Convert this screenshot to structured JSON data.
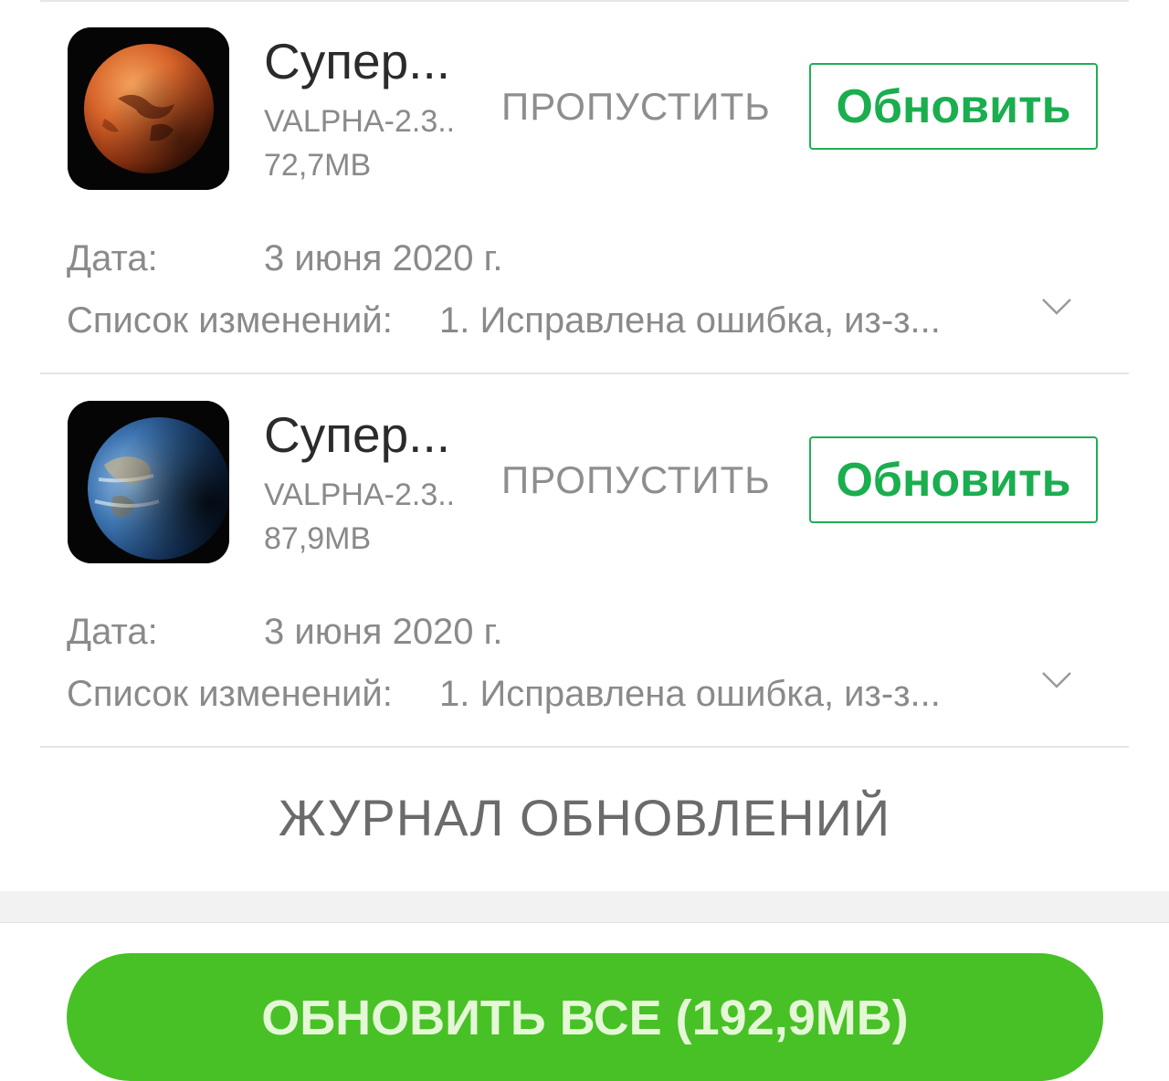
{
  "updates": [
    {
      "name": "Супер...",
      "version": "VALPHA-2.3..",
      "size": "72,7MB",
      "skip_label": "ПРОПУСТИТЬ",
      "update_label": "Обновить",
      "date_label": "Дата:",
      "date_value": "3 июня 2020 г.",
      "changelog_label": "Список изменений:",
      "changelog_value": "1. Исправлена ошибка, из-з...",
      "icon": "mars-wallpaper-icon"
    },
    {
      "name": "Супер...",
      "version": "VALPHA-2.3..",
      "size": "87,9MB",
      "skip_label": "ПРОПУСТИТЬ",
      "update_label": "Обновить",
      "date_label": "Дата:",
      "date_value": "3 июня 2020 г.",
      "changelog_label": "Список изменений:",
      "changelog_value": "1. Исправлена ошибка, из-з...",
      "icon": "earth-wallpaper-icon"
    }
  ],
  "journal_label": "ЖУРНАЛ ОБНОВЛЕНИЙ",
  "update_all_label": "ОБНОВИТЬ ВСЕ (192,9MB)",
  "colors": {
    "accent_green": "#1aae4f",
    "update_all_bg": "#47c126",
    "secondary_text": "#8a8a8a"
  }
}
